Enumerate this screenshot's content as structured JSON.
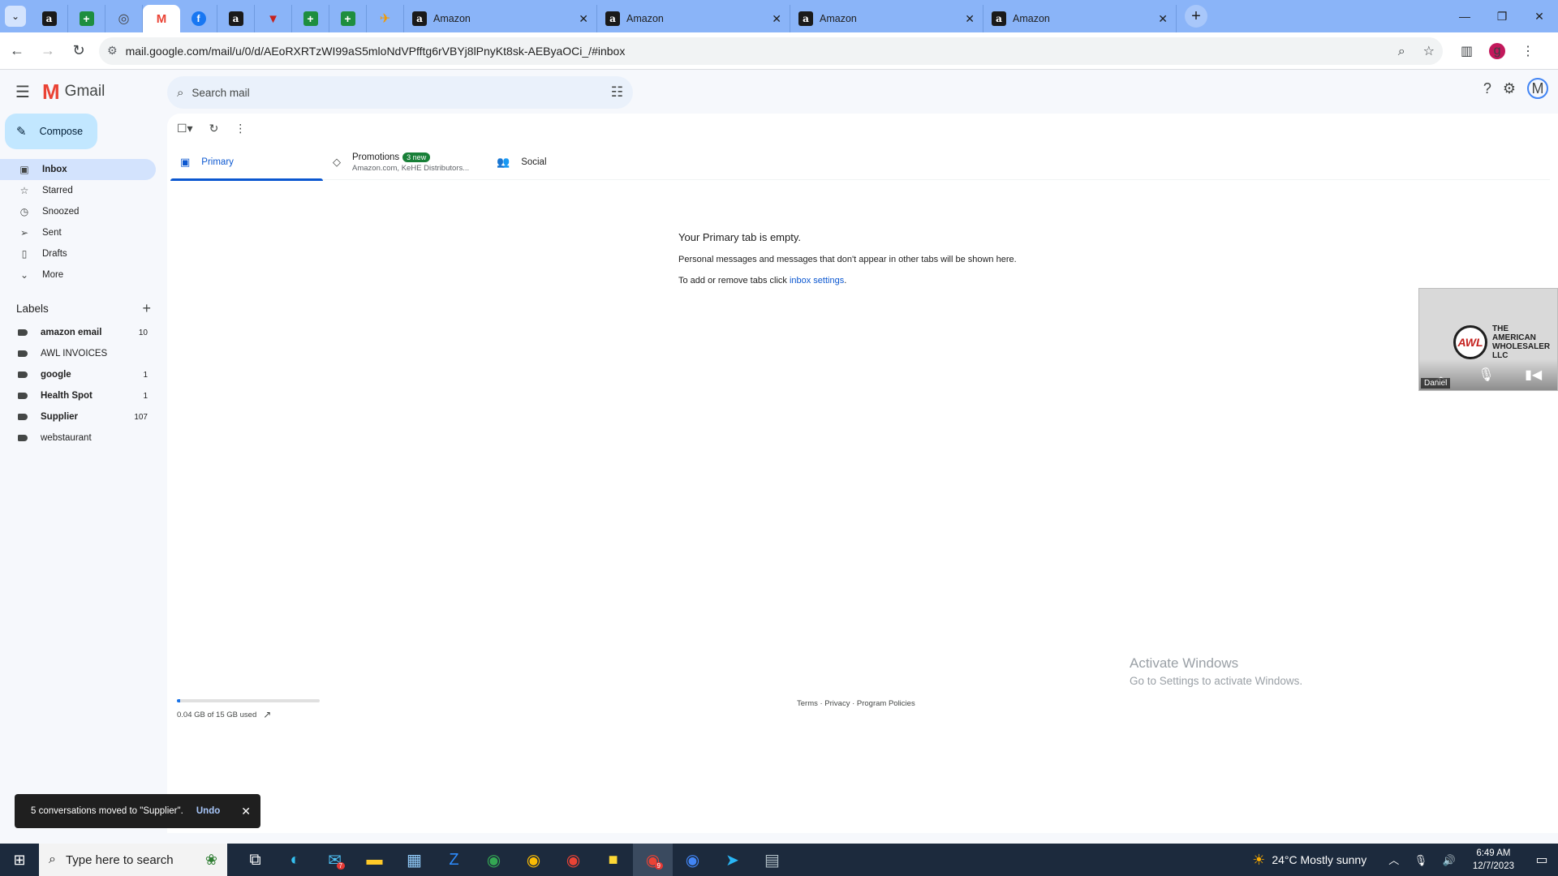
{
  "browser": {
    "pinned_tabs": [
      {
        "icon": "amazon-icon",
        "glyph": "a"
      },
      {
        "icon": "sheets-icon",
        "glyph": "+"
      },
      {
        "icon": "globe-icon",
        "glyph": "◎"
      },
      {
        "icon": "gmail-icon",
        "glyph": "M"
      },
      {
        "icon": "facebook-icon",
        "glyph": "f"
      },
      {
        "icon": "amazon-icon",
        "glyph": "a"
      },
      {
        "icon": "shield-icon",
        "glyph": "▼"
      },
      {
        "icon": "sheets-icon",
        "glyph": "+"
      },
      {
        "icon": "sheets-icon",
        "glyph": "+"
      },
      {
        "icon": "plane-icon",
        "glyph": "✈"
      }
    ],
    "tabs": [
      {
        "title": "Amazon"
      },
      {
        "title": "Amazon"
      },
      {
        "title": "Amazon"
      },
      {
        "title": "Amazon"
      }
    ],
    "url": "mail.google.com/mail/u/0/d/AEoRXRTzWI99aS5mloNdVPfftg6rVBYj8lPnyKt8sk-AEByaOCi_/#inbox",
    "profile_letter": "g"
  },
  "gmail": {
    "logo_text": "Gmail",
    "search_placeholder": "Search mail",
    "account_letter": "M",
    "compose_label": "Compose",
    "nav": [
      {
        "label": "Inbox",
        "icon": "inbox-icon",
        "glyph": "▣",
        "active": true
      },
      {
        "label": "Starred",
        "icon": "star-icon",
        "glyph": "☆"
      },
      {
        "label": "Snoozed",
        "icon": "clock-icon",
        "glyph": "◷"
      },
      {
        "label": "Sent",
        "icon": "send-icon",
        "glyph": "➢"
      },
      {
        "label": "Drafts",
        "icon": "draft-icon",
        "glyph": "▯"
      },
      {
        "label": "More",
        "icon": "chevron-down-icon",
        "glyph": "⌄"
      }
    ],
    "labels_heading": "Labels",
    "labels": [
      {
        "name": "amazon email",
        "count": "10",
        "bold": true
      },
      {
        "name": "AWL INVOICES",
        "count": "",
        "bold": false
      },
      {
        "name": "google",
        "count": "1",
        "bold": true
      },
      {
        "name": "Health Spot",
        "count": "1",
        "bold": true
      },
      {
        "name": "Supplier",
        "count": "107",
        "bold": true
      },
      {
        "name": "webstaurant",
        "count": "",
        "bold": false
      }
    ],
    "category_tabs": {
      "primary": "Primary",
      "promotions": "Promotions",
      "promotions_badge": "3 new",
      "promotions_sub": "Amazon.com, KeHE Distributors...",
      "social": "Social"
    },
    "empty_state": {
      "title": "Your Primary tab is empty.",
      "description": "Personal messages and messages that don't appear in other tabs will be shown here.",
      "settings_prefix": "To add or remove tabs click ",
      "settings_link": "inbox settings",
      "settings_suffix": "."
    },
    "storage": {
      "text": "0.04 GB of 15 GB used",
      "used_fraction": 0.003
    },
    "footer": "Terms · Privacy · Program Policies",
    "snackbar": {
      "message": "5 conversations moved to \"Supplier\".",
      "action": "Undo"
    }
  },
  "video_overlay": {
    "brand_line1": "THE",
    "brand_line2": "AMERICAN",
    "brand_line3": "WHOLESALER",
    "brand_line4": "LLC",
    "logo_text": "AWL",
    "participant": "Daniel"
  },
  "watermark": {
    "line1": "Activate Windows",
    "line2": "Go to Settings to activate Windows."
  },
  "taskbar": {
    "search_placeholder": "Type here to search",
    "weather": "24°C  Mostly sunny",
    "time": "6:49 AM",
    "date": "12/7/2023",
    "mail_badge": "7",
    "chrome_badge": "9"
  }
}
